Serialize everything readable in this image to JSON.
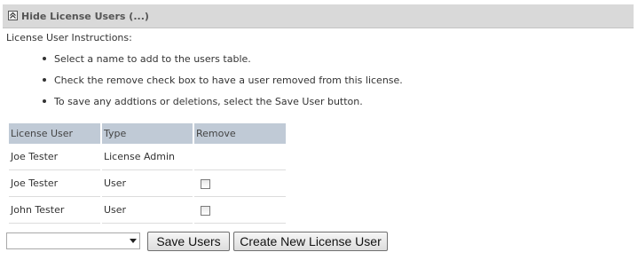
{
  "section": {
    "title": "Hide License Users (...)",
    "collapse_icon": "collapse-up-icon"
  },
  "instructions": {
    "label": "License User Instructions:",
    "items": [
      "Select a name to add to the users table.",
      "Check the remove check box to have a user removed from this license.",
      "To save any addtions or deletions, select the Save User button."
    ]
  },
  "users_table": {
    "headers": [
      "License User",
      "Type",
      "Remove"
    ],
    "rows": [
      {
        "user": "Joe Tester",
        "type": "License Admin",
        "removable": false,
        "checked": false
      },
      {
        "user": "Joe Tester",
        "type": "User",
        "removable": true,
        "checked": false
      },
      {
        "user": "John Tester",
        "type": "User",
        "removable": true,
        "checked": false
      }
    ]
  },
  "controls": {
    "user_select_value": "",
    "save_label": "Save Users",
    "create_label": "Create New License User"
  },
  "colors": {
    "header_bar": "#d9d9d9",
    "table_header": "#c0cad6"
  }
}
